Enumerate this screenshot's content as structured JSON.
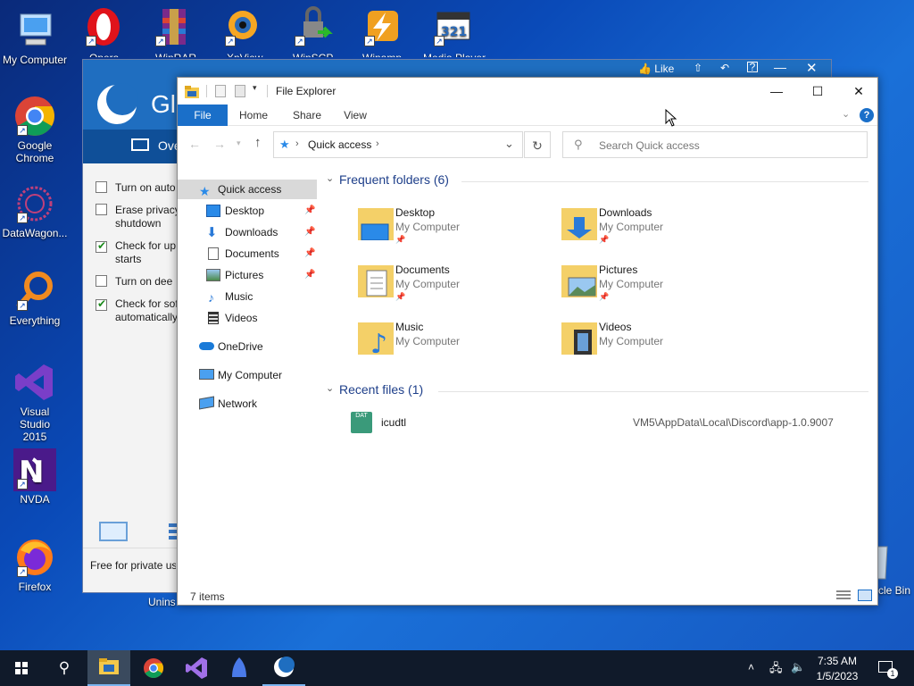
{
  "desktop": {
    "top_labels": [
      "Opera",
      "WinRAR",
      "XnView",
      "WinSCP",
      "Winamp",
      "Media Player Classic"
    ],
    "top_labels_visible": [
      "Opera",
      "WinRAR",
      "XnView",
      "WinSCP",
      "Winamp",
      "Media Player"
    ],
    "icons": [
      {
        "label": "My Computer"
      },
      {
        "label": "Google Chrome"
      },
      {
        "label": "DataWagon..."
      },
      {
        "label": "Everything"
      },
      {
        "label": "Visual Studio 2015"
      },
      {
        "label": "NVDA"
      },
      {
        "label": "Firefox"
      },
      {
        "label": "Recycle Bin"
      }
    ]
  },
  "bg_app": {
    "header_letter": "Gl",
    "title_like": "Like",
    "nav_label": "Ove",
    "options": [
      {
        "text": "Turn on auto",
        "checked": false
      },
      {
        "text": "Erase privacy",
        "text2": "shutdown",
        "checked": false
      },
      {
        "text": "Check for up",
        "text2": "starts",
        "checked": true
      },
      {
        "text": "Turn on dee",
        "checked": false
      },
      {
        "text": "Check for sof",
        "text2": "automatically",
        "checked": true
      }
    ],
    "footer_text": "Free for private us",
    "uninstall_label": "Unins"
  },
  "explorer": {
    "title": "File Explorer",
    "ribbon_tabs": [
      "File",
      "Home",
      "Share",
      "View"
    ],
    "address": "Quick access",
    "search_placeholder": "Search Quick access",
    "nav": [
      {
        "label": "Quick access",
        "pinned": false,
        "icon": "star-icon"
      },
      {
        "label": "Desktop",
        "pinned": true,
        "icon": "desktop-folder-icon"
      },
      {
        "label": "Downloads",
        "pinned": true,
        "icon": "downloads-icon"
      },
      {
        "label": "Documents",
        "pinned": true,
        "icon": "documents-icon"
      },
      {
        "label": "Pictures",
        "pinned": true,
        "icon": "pictures-icon"
      },
      {
        "label": "Music",
        "pinned": false,
        "icon": "music-icon"
      },
      {
        "label": "Videos",
        "pinned": false,
        "icon": "videos-icon"
      },
      {
        "label": "OneDrive",
        "pinned": false,
        "icon": "onedrive-icon"
      },
      {
        "label": "My Computer",
        "pinned": false,
        "icon": "computer-icon"
      },
      {
        "label": "Network",
        "pinned": false,
        "icon": "network-icon"
      }
    ],
    "frequent_header": "Frequent folders (6)",
    "folders": [
      {
        "name": "Desktop",
        "location": "My Computer",
        "pinned": true
      },
      {
        "name": "Downloads",
        "location": "My Computer",
        "pinned": true
      },
      {
        "name": "Documents",
        "location": "My Computer",
        "pinned": true
      },
      {
        "name": "Pictures",
        "location": "My Computer",
        "pinned": true
      },
      {
        "name": "Music",
        "location": "My Computer",
        "pinned": false
      },
      {
        "name": "Videos",
        "location": "My Computer",
        "pinned": false
      }
    ],
    "recent_header": "Recent files (1)",
    "recent": [
      {
        "name": "icudtl",
        "path": "VM5\\AppData\\Local\\Discord\\app-1.0.9007",
        "icon_text": "DAT"
      }
    ],
    "status": "7 items"
  },
  "taskbar": {
    "time": "7:35 AM",
    "date": "1/5/2023",
    "notifications": "1"
  },
  "colors": {
    "accent": "#1a6fc9",
    "desktop": "#0a4ab8",
    "taskbar": "#101a2a"
  }
}
